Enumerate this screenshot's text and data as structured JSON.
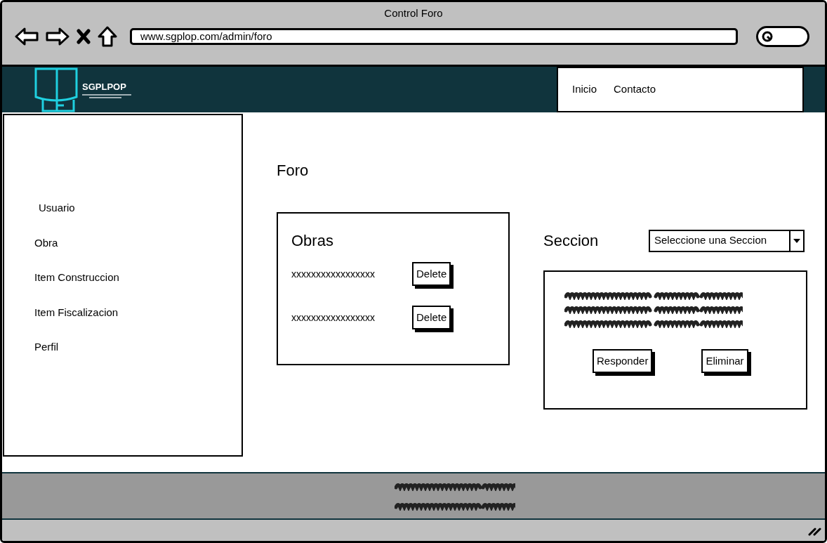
{
  "window": {
    "title": "Control Foro"
  },
  "address_bar": {
    "value": "www.sgplop.com/admin/foro"
  },
  "header": {
    "logo_text": "SGPLPOP",
    "nav": [
      "Inicio",
      "Contacto"
    ]
  },
  "sidebar": {
    "items": [
      "Usuario",
      "Obra",
      "Item Construccion",
      "Item Fiscalizacion",
      "Perfil"
    ]
  },
  "page_title": "Foro",
  "obras": {
    "title": "Obras",
    "rows": [
      {
        "text": "xxxxxxxxxxxxxxxxx",
        "button": "Delete"
      },
      {
        "text": "xxxxxxxxxxxxxxxxx",
        "button": "Delete"
      }
    ]
  },
  "seccion": {
    "label": "Seccion",
    "dropdown": "Seleccione una Seccion",
    "buttons": [
      "Responder",
      "Eliminar"
    ]
  }
}
